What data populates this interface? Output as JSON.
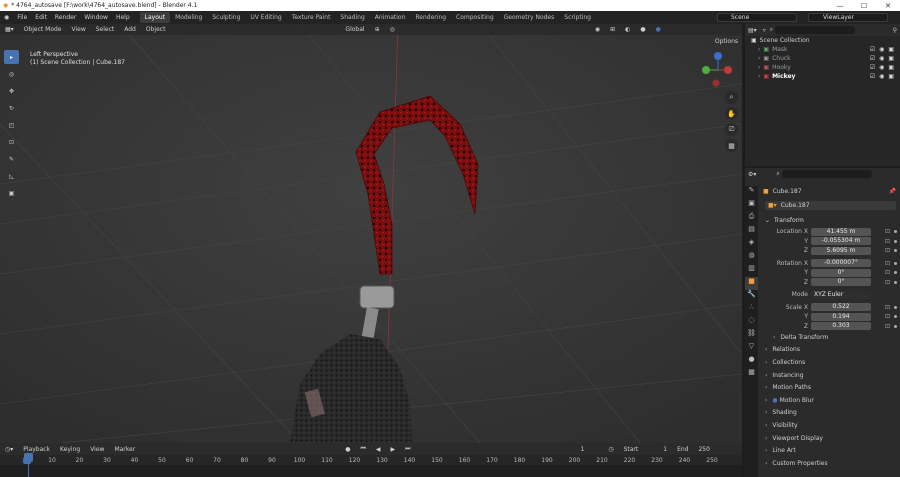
{
  "window": {
    "title": "* 4764_autosave [F:\\work\\4764_autosave.blend] - Blender 4.1",
    "minimize": "—",
    "maximize": "☐",
    "close": "✕"
  },
  "menu": [
    "File",
    "Edit",
    "Render",
    "Window",
    "Help"
  ],
  "workspaces": [
    {
      "label": "Layout",
      "active": true
    },
    {
      "label": "Modeling"
    },
    {
      "label": "Sculpting"
    },
    {
      "label": "UV Editing"
    },
    {
      "label": "Texture Paint"
    },
    {
      "label": "Shading"
    },
    {
      "label": "Animation"
    },
    {
      "label": "Rendering"
    },
    {
      "label": "Compositing"
    },
    {
      "label": "Geometry Nodes"
    },
    {
      "label": "Scripting"
    }
  ],
  "scene_name": "Scene",
  "view_layer": "ViewLayer",
  "viewport": {
    "mode": "Object Mode",
    "menus": [
      "View",
      "Select",
      "Add",
      "Object"
    ],
    "transform_orientation": "Global",
    "options": "Options",
    "view_name": "Left Perspective",
    "collection_info": "(1) Scene Collection | Cube.187"
  },
  "tools": [
    "select-box",
    "cursor",
    "move",
    "rotate",
    "scale",
    "transform",
    "annotate",
    "measure",
    "add-cube"
  ],
  "outliner": {
    "search_placeholder": "",
    "root": "Scene Collection",
    "items": [
      {
        "label": "Mask",
        "color": "#5fae5f"
      },
      {
        "label": "Chuck",
        "color": "#9a9a9a"
      },
      {
        "label": "Hooky",
        "color": "#c05a5a"
      },
      {
        "label": "Mickey",
        "color": "#d04040"
      }
    ]
  },
  "properties": {
    "object_name": "Cube.187",
    "datablock": "Cube.187",
    "transform_label": "Transform",
    "location": {
      "label": "Location X",
      "x": "41.455 m",
      "y": "-0.055304 m",
      "z": "5.6095 m"
    },
    "rotation": {
      "label": "Rotation X",
      "x": "-0.000007°",
      "y": "0°",
      "z": "0°"
    },
    "mode": {
      "label": "Mode",
      "value": "XYZ Euler"
    },
    "scale": {
      "label": "Scale X",
      "x": "0.522",
      "y": "0.194",
      "z": "0.303"
    },
    "axis_y": "Y",
    "axis_z": "Z",
    "sections": [
      "Delta Transform",
      "Relations",
      "Collections",
      "Instancing",
      "Motion Paths",
      "Motion Blur",
      "Shading",
      "Visibility",
      "Viewport Display",
      "Line Art",
      "Custom Properties"
    ]
  },
  "timeline": {
    "menus": [
      "Playback",
      "Keying",
      "View",
      "Marker"
    ],
    "current_frame": "1",
    "start_label": "Start",
    "start": "1",
    "end_label": "End",
    "end": "250",
    "ticks": [
      "1",
      "10",
      "20",
      "30",
      "40",
      "50",
      "60",
      "70",
      "80",
      "90",
      "100",
      "110",
      "120",
      "130",
      "140",
      "150",
      "160",
      "170",
      "180",
      "190",
      "200",
      "210",
      "220",
      "230",
      "240",
      "250"
    ]
  },
  "colors": {
    "accent": "#4772b3",
    "active_ws": "#3d3d3d",
    "hook_red": "#8b1010"
  }
}
